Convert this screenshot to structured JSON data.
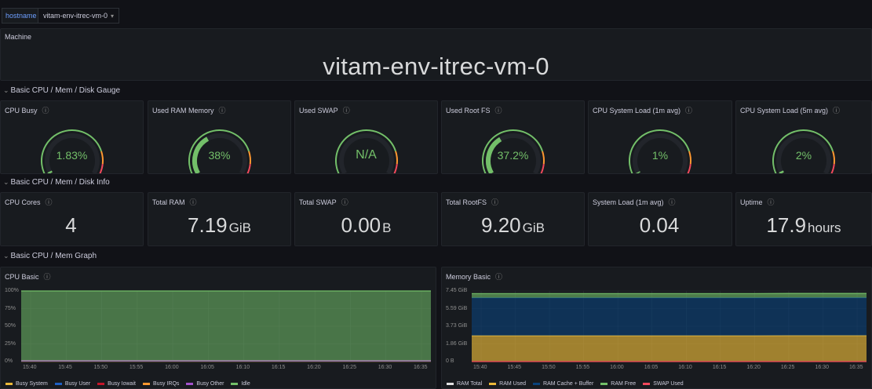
{
  "variables": {
    "label": "hostname",
    "value": "vitam-env-itrec-vm-0",
    "chevron_icon": "chevron-down-icon"
  },
  "machine": {
    "title": "Machine",
    "value": "vitam-env-itrec-vm-0"
  },
  "rows": {
    "gauge": "Basic CPU / Mem / Disk Gauge",
    "info": "Basic CPU / Mem / Disk Info",
    "graph": "Basic CPU / Mem Graph"
  },
  "gauges": [
    {
      "title": "CPU Busy",
      "value": "1.83%",
      "fraction": 0.0183,
      "fill": "#73bf69"
    },
    {
      "title": "Used RAM Memory",
      "value": "38%",
      "fraction": 0.38,
      "fill": "#73bf69"
    },
    {
      "title": "Used SWAP",
      "value": "N/A",
      "fraction": 0,
      "fill": "#73bf69"
    },
    {
      "title": "Used Root FS",
      "value": "37.2%",
      "fraction": 0.372,
      "fill": "#73bf69"
    },
    {
      "title": "CPU System Load (1m avg)",
      "value": "1%",
      "fraction": 0.01,
      "fill": "#73bf69"
    },
    {
      "title": "CPU System Load (5m avg)",
      "value": "2%",
      "fraction": 0.02,
      "fill": "#73bf69"
    }
  ],
  "stats": [
    {
      "title": "CPU Cores",
      "value": "4",
      "unit": ""
    },
    {
      "title": "Total RAM",
      "value": "7.19",
      "unit": "GiB"
    },
    {
      "title": "Total SWAP",
      "value": "0.00",
      "unit": "B"
    },
    {
      "title": "Total RootFS",
      "value": "9.20",
      "unit": "GiB"
    },
    {
      "title": "System Load (1m avg)",
      "value": "0.04",
      "unit": ""
    },
    {
      "title": "Uptime",
      "value": "17.9",
      "unit": "hours"
    }
  ],
  "chart_data": [
    {
      "type": "area",
      "title": "CPU Basic",
      "y_ticks": [
        "100%",
        "75%",
        "50%",
        "25%",
        "0%"
      ],
      "ylim": [
        0,
        100
      ],
      "x_ticks": [
        "15:40",
        "15:45",
        "15:50",
        "15:55",
        "16:00",
        "16:05",
        "16:10",
        "16:15",
        "16:20",
        "16:25",
        "16:30",
        "16:35"
      ],
      "series": [
        {
          "name": "Busy System",
          "color": "#eab839",
          "values": [
            0.4,
            0.4,
            0.4,
            0.4,
            0.4,
            0.4,
            0.4,
            0.4,
            0.4,
            0.4,
            0.4,
            0.4
          ]
        },
        {
          "name": "Busy User",
          "color": "#1f60c4",
          "values": [
            0.6,
            0.6,
            0.6,
            0.6,
            0.6,
            0.6,
            0.6,
            0.6,
            0.6,
            0.6,
            0.6,
            0.6
          ]
        },
        {
          "name": "Busy Iowait",
          "color": "#c4162a",
          "values": [
            0.2,
            0.2,
            0.2,
            0.2,
            0.2,
            0.2,
            0.2,
            0.2,
            0.2,
            0.2,
            0.2,
            0.2
          ]
        },
        {
          "name": "Busy IRQs",
          "color": "#ff9830",
          "values": [
            0,
            0,
            0,
            0,
            0,
            0,
            0,
            0,
            0,
            0,
            0,
            0
          ]
        },
        {
          "name": "Busy Other",
          "color": "#a352cc",
          "values": [
            0,
            0,
            0,
            0,
            0,
            0,
            0,
            0,
            0,
            0,
            0,
            0
          ]
        },
        {
          "name": "Idle",
          "color": "#73bf69",
          "values": [
            98.8,
            98.8,
            98.8,
            98.8,
            98.8,
            98.8,
            98.8,
            98.8,
            98.8,
            98.8,
            98.8,
            98.8
          ]
        }
      ]
    },
    {
      "type": "area",
      "title": "Memory Basic",
      "y_ticks": [
        "7.45 GiB",
        "5.59 GiB",
        "3.73 GiB",
        "1.86 GiB",
        "0 B"
      ],
      "ylim": [
        0,
        7.45
      ],
      "x_ticks": [
        "15:40",
        "15:45",
        "15:50",
        "15:55",
        "16:00",
        "16:05",
        "16:10",
        "16:15",
        "16:20",
        "16:25",
        "16:30",
        "16:35"
      ],
      "series": [
        {
          "name": "RAM Total",
          "color": "#e0e0e0",
          "values": [
            7.19,
            7.19,
            7.19,
            7.19,
            7.19,
            7.19,
            7.19,
            7.19,
            7.19,
            7.19,
            7.19,
            7.19
          ]
        },
        {
          "name": "RAM Used",
          "color": "#eab839",
          "values": [
            2.73,
            2.73,
            2.73,
            2.73,
            2.73,
            2.73,
            2.73,
            2.73,
            2.73,
            2.74,
            2.74,
            2.74
          ]
        },
        {
          "name": "RAM Cache + Buffer",
          "color": "#0a437c",
          "values": [
            4.0,
            4.0,
            4.0,
            4.0,
            4.0,
            4.0,
            4.0,
            4.0,
            4.0,
            4.0,
            4.0,
            4.0
          ]
        },
        {
          "name": "RAM Free",
          "color": "#73bf69",
          "values": [
            0.45,
            0.45,
            0.45,
            0.45,
            0.45,
            0.45,
            0.45,
            0.45,
            0.45,
            0.45,
            0.45,
            0.45
          ]
        },
        {
          "name": "SWAP Used",
          "color": "#f2495c",
          "values": [
            0,
            0,
            0,
            0,
            0,
            0,
            0,
            0,
            0,
            0,
            0,
            0
          ]
        }
      ]
    }
  ]
}
